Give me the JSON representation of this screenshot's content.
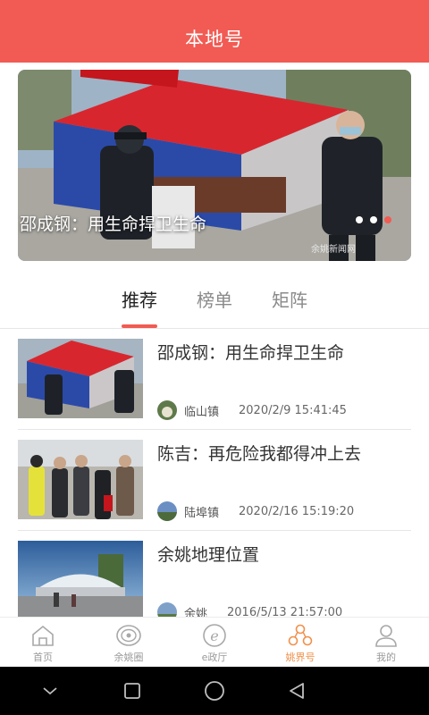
{
  "header": {
    "title": "本地号"
  },
  "banner": {
    "caption": "邵成钢：用生命捍卫生命",
    "dots_total": 3,
    "active_dot": 3,
    "watermark": "余姚新闻网"
  },
  "tabs": [
    {
      "label": "推荐",
      "active": true
    },
    {
      "label": "榜单",
      "active": false
    },
    {
      "label": "矩阵",
      "active": false
    }
  ],
  "news": [
    {
      "title": "邵成钢：用生命捍卫生命",
      "source": "临山镇",
      "time": "2020/2/9 15:41:45",
      "thumb": "tent-checkpoint-icon"
    },
    {
      "title": "陈吉：再危险我都得冲上去",
      "source": "陆埠镇",
      "time": "2020/2/16 15:19:20",
      "thumb": "workers-group-icon"
    },
    {
      "title": "余姚地理位置",
      "source": "余姚",
      "time": "2016/5/13 21:57:00",
      "thumb": "stadium-dusk-icon"
    }
  ],
  "bottom_nav": [
    {
      "label": "首页",
      "icon": "home-icon",
      "active": false
    },
    {
      "label": "余姚圈",
      "icon": "circle-icon",
      "active": false
    },
    {
      "label": "e政厅",
      "icon": "e-hall-icon",
      "active": false
    },
    {
      "label": "姚界号",
      "icon": "network-icon",
      "active": true
    },
    {
      "label": "我的",
      "icon": "profile-icon",
      "active": false
    }
  ],
  "colors": {
    "accent": "#f15b53",
    "nav_active": "#f0904a"
  }
}
